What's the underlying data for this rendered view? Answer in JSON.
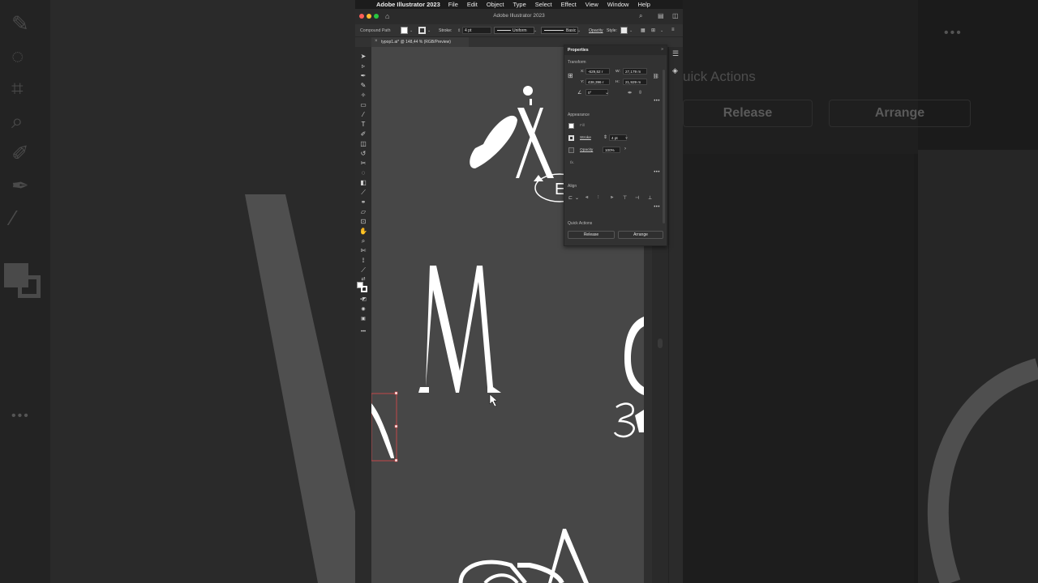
{
  "menubar": {
    "app_name": "Adobe Illustrator 2023",
    "items": [
      "File",
      "Edit",
      "Object",
      "Type",
      "Select",
      "Effect",
      "View",
      "Window",
      "Help"
    ]
  },
  "window": {
    "title": "Adobe Illustrator 2023",
    "document_tab": "typop1.ai* @ 148,44 % (RGB/Preview)"
  },
  "control_bar": {
    "selection_type": "Compound Path",
    "stroke_label": "Stroke:",
    "stroke_weight": "4 pt",
    "profile": "Uniform",
    "brush": "Basic",
    "opacity_label": "Opacity",
    "style_label": "Style:"
  },
  "properties": {
    "title": "Properties",
    "transform": {
      "label": "Transform",
      "x_label": "X:",
      "x_value": "-629,52 r",
      "y_label": "Y:",
      "y_value": "438,396 r",
      "w_label": "W:",
      "w_value": "27,179 m",
      "h_label": "H:",
      "h_value": "21,929 m",
      "angle_value": "0°"
    },
    "appearance": {
      "label": "Appearance",
      "fill_label": "Fill",
      "stroke_label": "Stroke",
      "stroke_value": "4 pt",
      "opacity_label": "Opacity",
      "opacity_value": "100%",
      "fx_label": "fx."
    },
    "align": {
      "label": "Align"
    },
    "quick_actions": {
      "label": "Quick Actions",
      "release_label": "Release",
      "arrange_label": "Arrange"
    }
  },
  "background_echo": {
    "quick_actions": "uick Actions",
    "release": "Release",
    "arrange": "Arrange"
  },
  "colors": {
    "canvas": "#474747",
    "panel": "#323232",
    "artwork": "#ffffff",
    "selection": "#e0484a"
  }
}
